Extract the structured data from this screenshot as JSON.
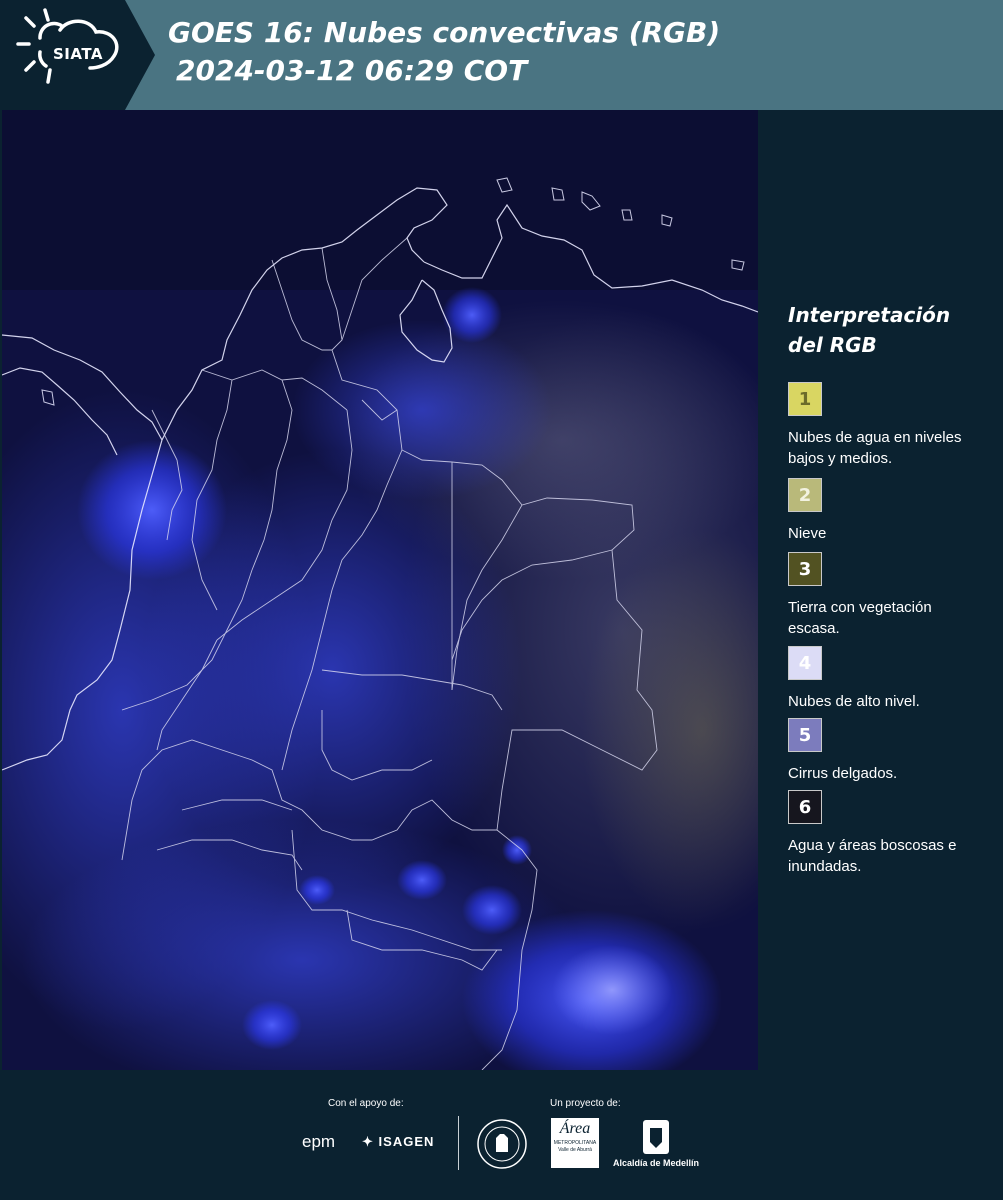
{
  "header": {
    "logo_label": "SIATA",
    "title": "GOES 16: Nubes convectivas (RGB)",
    "subtitle": "2024-03-12 06:29 COT"
  },
  "legend": {
    "title_line1": "Interpretación",
    "title_line2": "del RGB",
    "items": [
      {
        "num": "1",
        "label": "Nubes de agua en niveles bajos y medios.",
        "color": "#d9d662",
        "text_color": "#6b6b2a"
      },
      {
        "num": "2",
        "label": "Nieve",
        "color": "#b9b97a",
        "text_color": "#f2f2e0"
      },
      {
        "num": "3",
        "label": "Tierra con vegetación escasa.",
        "color": "#525222",
        "text_color": "#ffffff"
      },
      {
        "num": "4",
        "label": "Nubes de alto nivel.",
        "color": "#dcdcf6",
        "text_color": "#ffffff"
      },
      {
        "num": "5",
        "label": "Cirrus delgados.",
        "color": "#7c7cbd",
        "text_color": "#ffffff"
      },
      {
        "num": "6",
        "label": "Agua y áreas boscosas e inundadas.",
        "color": "#16161e",
        "text_color": "#ffffff"
      }
    ]
  },
  "footer": {
    "support_caption": "Con el apoyo de:",
    "project_caption": "Un proyecto de:",
    "logo_epm": "epm",
    "logo_isagen": "ISAGEN",
    "logo_area": "Área",
    "logo_area_sub": "METROPOLITANA",
    "logo_area_sub2": "Valle de Aburrá",
    "logo_alcaldia": "Alcaldía de Medellín"
  },
  "colors": {
    "header_bg": "#4a7482",
    "panel_bg": "#0b2230",
    "map_bg": "#0f1140",
    "convection": "#2e3cff"
  }
}
